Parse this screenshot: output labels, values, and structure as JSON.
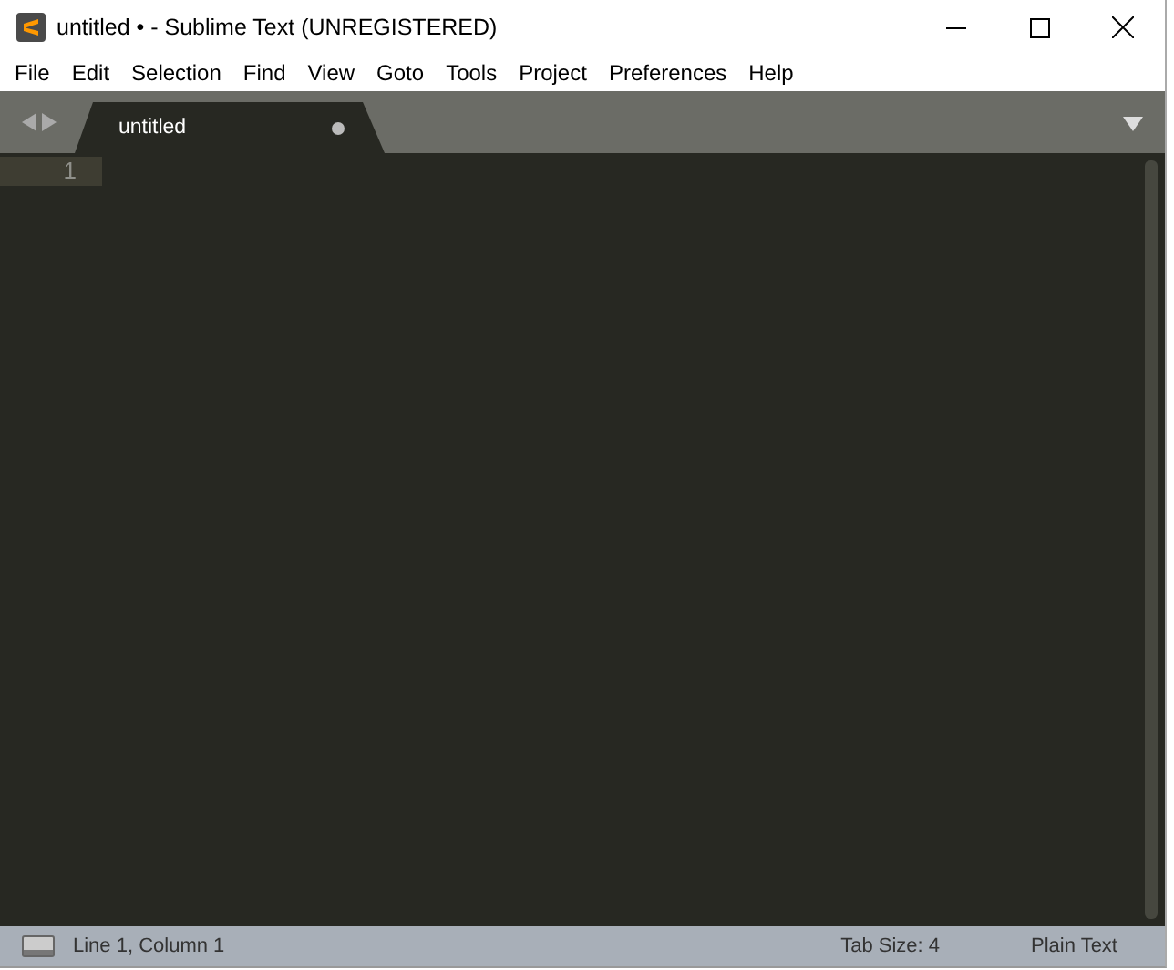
{
  "window": {
    "title": "untitled • - Sublime Text (UNREGISTERED)"
  },
  "menu": [
    "File",
    "Edit",
    "Selection",
    "Find",
    "View",
    "Goto",
    "Tools",
    "Project",
    "Preferences",
    "Help"
  ],
  "tabs": [
    {
      "label": "untitled",
      "selected": true,
      "modified": true
    }
  ],
  "editor": {
    "line_numbers": [
      "1"
    ]
  },
  "status_bar": {
    "position": "Line 1, Column 1",
    "tab_size": "Tab Size: 4",
    "syntax": "Plain Text"
  }
}
